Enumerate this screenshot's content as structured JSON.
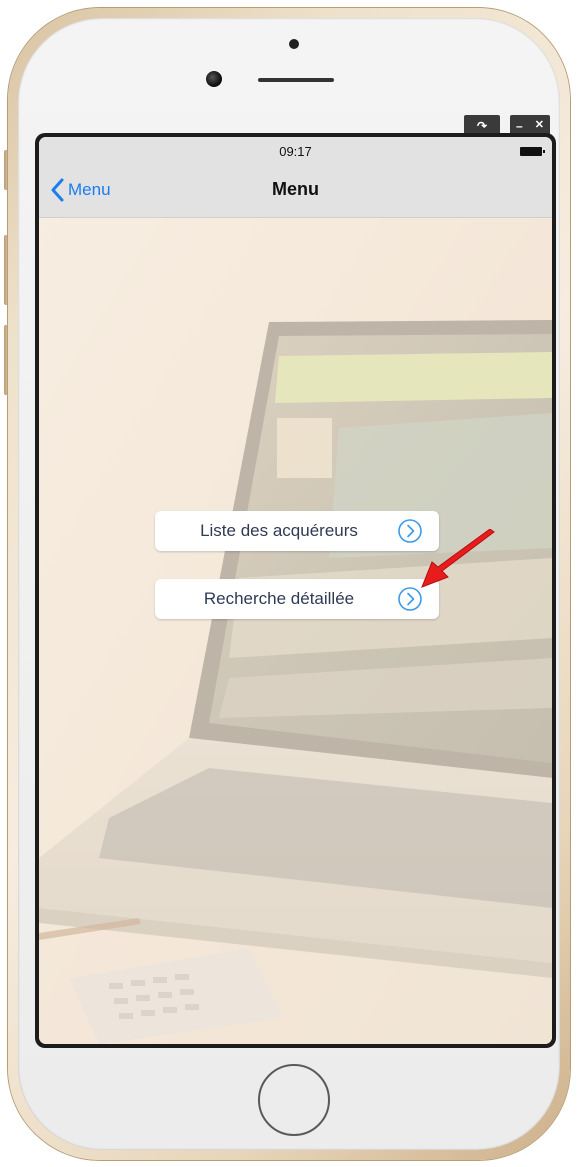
{
  "emulator": {
    "rotate_label": "↷",
    "minimize_label": "–",
    "close_label": "✕"
  },
  "status_bar": {
    "time": "09:17"
  },
  "nav_bar": {
    "back_label": "Menu",
    "title": "Menu"
  },
  "menu": {
    "items": [
      {
        "label": "Liste des acquéreurs",
        "icon": "chevron-circle-right-icon"
      },
      {
        "label": "Recherche détaillée",
        "icon": "chevron-circle-right-icon"
      }
    ]
  },
  "colors": {
    "accent": "#1a7df0",
    "annotation_arrow": "#e81c1c",
    "bar_background": "#e2e2e2"
  }
}
